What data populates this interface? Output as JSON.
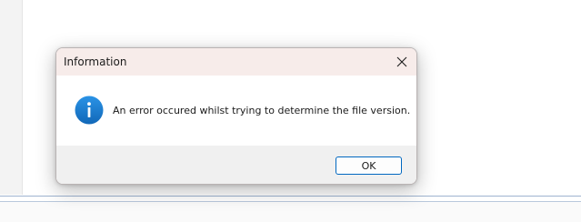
{
  "dialog": {
    "title": "Information",
    "message": "An error occured whilst trying to determine the file version.",
    "ok_label": "OK",
    "icon": "info-icon",
    "close_icon": "close-icon"
  },
  "colors": {
    "titlebar_bg": "#f7ecea",
    "footer_bg": "#f0f0f0",
    "info_blue": "#1a7fd4",
    "button_border": "#0067c0"
  }
}
